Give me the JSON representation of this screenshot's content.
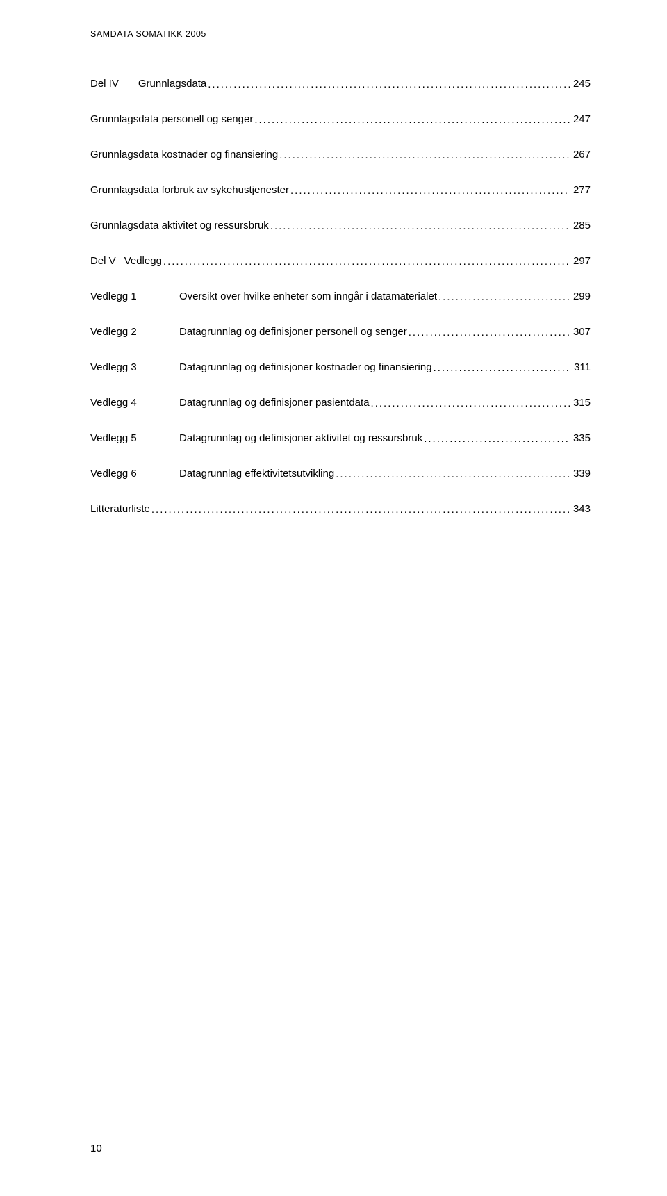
{
  "header": "SAMDATA SOMATIKK 2005",
  "toc": {
    "partIV": {
      "prefix": "Del IV",
      "title": "Grunnlagsdata",
      "page": "245"
    },
    "items1": [
      {
        "text": "Grunnlagsdata personell og senger",
        "page": "247"
      },
      {
        "text": "Grunnlagsdata kostnader og finansiering",
        "page": "267"
      },
      {
        "text": "Grunnlagsdata forbruk av sykehustjenester",
        "page": "277"
      },
      {
        "text": "Grunnlagsdata aktivitet og ressursbruk",
        "page": "285"
      }
    ],
    "partV": {
      "prefix": "Del V",
      "title": "Vedlegg",
      "page": "297"
    },
    "appendices": [
      {
        "label": "Vedlegg 1",
        "text": "Oversikt over hvilke enheter som inngår i datamaterialet",
        "page": "299"
      },
      {
        "label": "Vedlegg 2",
        "text": "Datagrunnlag og definisjoner personell og senger",
        "page": "307"
      },
      {
        "label": "Vedlegg 3",
        "text": "Datagrunnlag og definisjoner kostnader og finansiering",
        "page": "311"
      },
      {
        "label": "Vedlegg 4",
        "text": "Datagrunnlag og definisjoner pasientdata",
        "page": "315"
      },
      {
        "label": "Vedlegg 5",
        "text": "Datagrunnlag og definisjoner aktivitet og ressursbruk",
        "page": "335"
      },
      {
        "label": "Vedlegg 6",
        "text": "Datagrunnlag effektivitetsutvikling",
        "page": "339"
      }
    ],
    "litteraturliste": {
      "text": "Litteraturliste",
      "page": "343"
    }
  },
  "footerPage": "10"
}
